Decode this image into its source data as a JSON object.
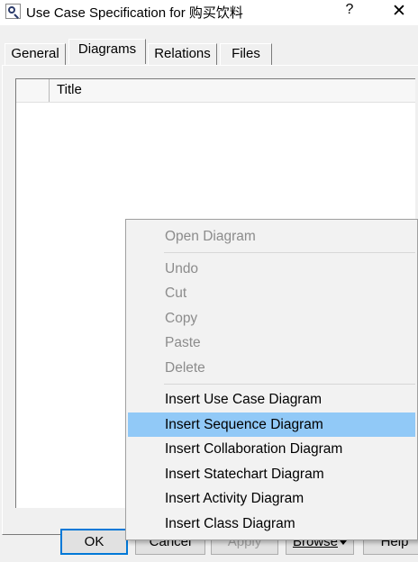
{
  "window": {
    "title": "Use Case Specification for 购买饮料",
    "help_glyph": "?",
    "close_glyph": "✕"
  },
  "tabs": [
    {
      "label": "General"
    },
    {
      "label": "Diagrams"
    },
    {
      "label": "Relations"
    },
    {
      "label": "Files"
    }
  ],
  "list": {
    "columns": [
      "",
      "Title"
    ]
  },
  "buttons": {
    "ok": "OK",
    "cancel": "Cancel",
    "apply": "Apply",
    "browse": "Browse",
    "help": "Help"
  },
  "context_menu": {
    "items": [
      {
        "label": "Open Diagram",
        "enabled": false
      },
      {
        "label": "Undo",
        "enabled": false
      },
      {
        "label": "Cut",
        "enabled": false
      },
      {
        "label": "Copy",
        "enabled": false
      },
      {
        "label": "Paste",
        "enabled": false
      },
      {
        "label": "Delete",
        "enabled": false
      },
      {
        "label": "Insert Use Case Diagram",
        "enabled": true
      },
      {
        "label": "Insert Sequence Diagram",
        "enabled": true,
        "highlighted": true
      },
      {
        "label": "Insert Collaboration Diagram",
        "enabled": true
      },
      {
        "label": "Insert Statechart Diagram",
        "enabled": true
      },
      {
        "label": "Insert Activity Diagram",
        "enabled": true
      },
      {
        "label": "Insert Class Diagram",
        "enabled": true
      }
    ]
  },
  "colors": {
    "menu_highlight": "#91c9f7",
    "dialog_bg": "#f0f0f0",
    "default_button_border": "#0078d7"
  }
}
